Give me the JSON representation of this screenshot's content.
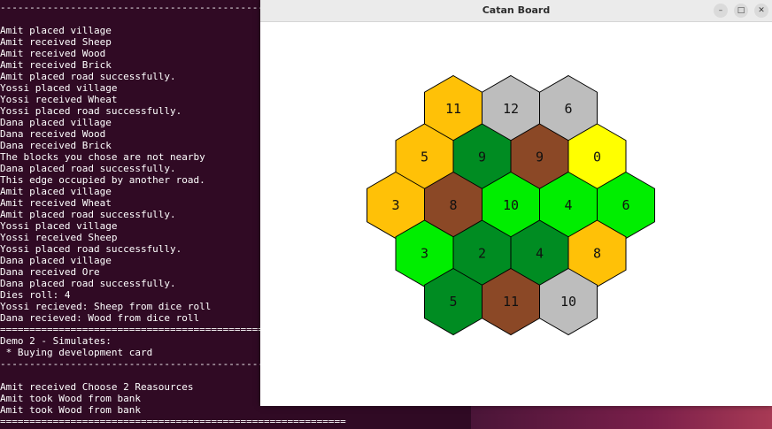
{
  "terminal": {
    "lines": [
      "-----------------------------------------------------------",
      "",
      "Amit placed village",
      "Amit received Sheep",
      "Amit received Wood",
      "Amit received Brick",
      "Amit placed road successfully.",
      "Yossi placed village",
      "Yossi received Wheat",
      "Yossi placed road successfully.",
      "Dana placed village",
      "Dana received Wood",
      "Dana received Brick",
      "The blocks you chose are not nearby",
      "Dana placed road successfully.",
      "This edge occupied by another road.",
      "Amit placed village",
      "Amit received Wheat",
      "Amit placed road successfully.",
      "Yossi placed village",
      "Yossi received Sheep",
      "Yossi placed road successfully.",
      "Dana placed village",
      "Dana received Ore",
      "Dana placed road successfully.",
      "Dies roll: 4",
      "Yossi recieved: Sheep from dice roll",
      "Dana recieved: Wood from dice roll",
      "===========================================================",
      "Demo 2 - Simulates:",
      " * Buying development card",
      "-----------------------------------------------------------",
      "",
      "Amit received Choose 2 Reasources",
      "Amit took Wood from bank",
      "Amit took Wood from bank",
      "==========================================================="
    ]
  },
  "window": {
    "title": "Catan Board",
    "minimize_glyph": "–",
    "maximize_glyph": "□",
    "close_glyph": "✕"
  },
  "colors": {
    "wheat": "#ffc107",
    "sheep": "#00ee00",
    "wood": "#008c22",
    "brick": "#8b4826",
    "ore": "#bdbdbd",
    "desert": "#ffff00"
  },
  "board": {
    "rows": [
      [
        {
          "number": "11",
          "resource": "wheat"
        },
        {
          "number": "12",
          "resource": "ore"
        },
        {
          "number": "6",
          "resource": "ore"
        }
      ],
      [
        {
          "number": "5",
          "resource": "wheat"
        },
        {
          "number": "9",
          "resource": "wood"
        },
        {
          "number": "9",
          "resource": "brick"
        },
        {
          "number": "0",
          "resource": "desert"
        }
      ],
      [
        {
          "number": "3",
          "resource": "wheat"
        },
        {
          "number": "8",
          "resource": "brick"
        },
        {
          "number": "10",
          "resource": "sheep"
        },
        {
          "number": "4",
          "resource": "sheep"
        },
        {
          "number": "6",
          "resource": "sheep"
        }
      ],
      [
        {
          "number": "3",
          "resource": "sheep"
        },
        {
          "number": "2",
          "resource": "wood"
        },
        {
          "number": "4",
          "resource": "wood"
        },
        {
          "number": "8",
          "resource": "wheat"
        }
      ],
      [
        {
          "number": "5",
          "resource": "wood"
        },
        {
          "number": "11",
          "resource": "brick"
        },
        {
          "number": "10",
          "resource": "ore"
        }
      ]
    ]
  }
}
